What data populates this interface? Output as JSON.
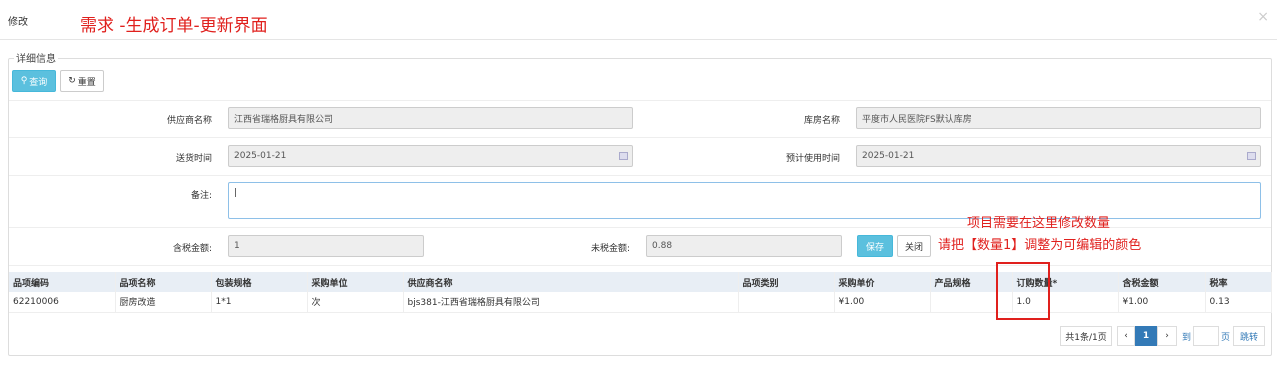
{
  "header": {
    "modal_title": "修改",
    "requirement_title": "需求 -生成订单-更新界面",
    "close_label": "×"
  },
  "fieldset": {
    "legend": "详细信息"
  },
  "toolbar": {
    "query_label": "查询",
    "reset_label": "重置"
  },
  "form": {
    "supplier_label": "供应商名称",
    "supplier_value": "江西省瑞格厨具有限公司",
    "warehouse_label": "库房名称",
    "warehouse_value": "平度市人民医院FS默认库房",
    "delivery_label": "送货时间",
    "delivery_value": "2025-01-21",
    "expected_label": "预计使用时间",
    "expected_value": "2025-01-21",
    "remark_label": "备注:",
    "remark_value": "",
    "tax_incl_label": "含税金额:",
    "tax_incl_value": "1",
    "tax_excl_label": "未税金额:",
    "tax_excl_value": "0.88",
    "save_label": "保存",
    "close_label": "关闭"
  },
  "annotations": {
    "line1": "项目需要在这里修改数量",
    "line2": "请把【数量1】调整为可编辑的颜色"
  },
  "table": {
    "columns": [
      "品项编码",
      "品项名称",
      "包装规格",
      "采购单位",
      "供应商名称",
      "品项类别",
      "采购单价",
      "产品规格",
      "订购数量*",
      "含税金额",
      "税率"
    ],
    "rows": [
      [
        "62210006",
        "厨房改造",
        "1*1",
        "次",
        "bjs381-江西省瑞格厨具有限公司",
        "",
        "¥1.00",
        "",
        "1.0",
        "¥1.00",
        "0.13"
      ]
    ]
  },
  "pagination": {
    "summary": "共1条/1页",
    "prev": "‹",
    "current": "1",
    "next": "›",
    "goto_prefix": "到",
    "goto_suffix": "页",
    "jump_label": "跳转"
  }
}
